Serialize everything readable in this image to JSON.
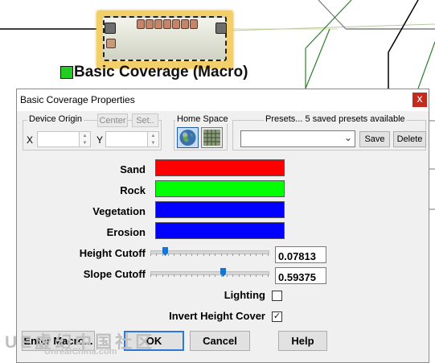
{
  "node": {
    "label": "Basic Coverage (Macro)",
    "icon_color": "#22cc22"
  },
  "dialog": {
    "title": "Basic Coverage Properties",
    "close_glyph": "x",
    "device_origin": {
      "label": "Device Origin",
      "center_label": "Center",
      "set_label": "Set..",
      "x_label": "X",
      "y_label": "Y",
      "x_value": "",
      "y_value": ""
    },
    "home_space": {
      "label": "Home Space"
    },
    "presets": {
      "label": "Presets... 5 saved presets available",
      "selected": "",
      "save_label": "Save",
      "delete_label": "Delete"
    },
    "colors": [
      {
        "label": "Sand",
        "color": "#ff0000"
      },
      {
        "label": "Rock",
        "color": "#00ff00"
      },
      {
        "label": "Vegetation",
        "color": "#0000ff"
      },
      {
        "label": "Erosion",
        "color": "#0000ff"
      }
    ],
    "height_cutoff": {
      "label": "Height Cutoff",
      "value": "0.07813",
      "level": 0.07813
    },
    "slope_cutoff": {
      "label": "Slope Cutoff",
      "value": "0.59375",
      "level": 0.59375
    },
    "lighting": {
      "label": "Lighting",
      "checked": false
    },
    "invert_height_cover": {
      "label": "Invert Height Cover",
      "checked": true,
      "check_glyph": "✓"
    },
    "buttons": {
      "enter_macro": "Enter Macro...",
      "ok": "OK",
      "cancel": "Cancel",
      "help": "Help"
    }
  },
  "watermark": {
    "text": "UE虚幻中国社区",
    "url": "UnrealChina.com"
  }
}
